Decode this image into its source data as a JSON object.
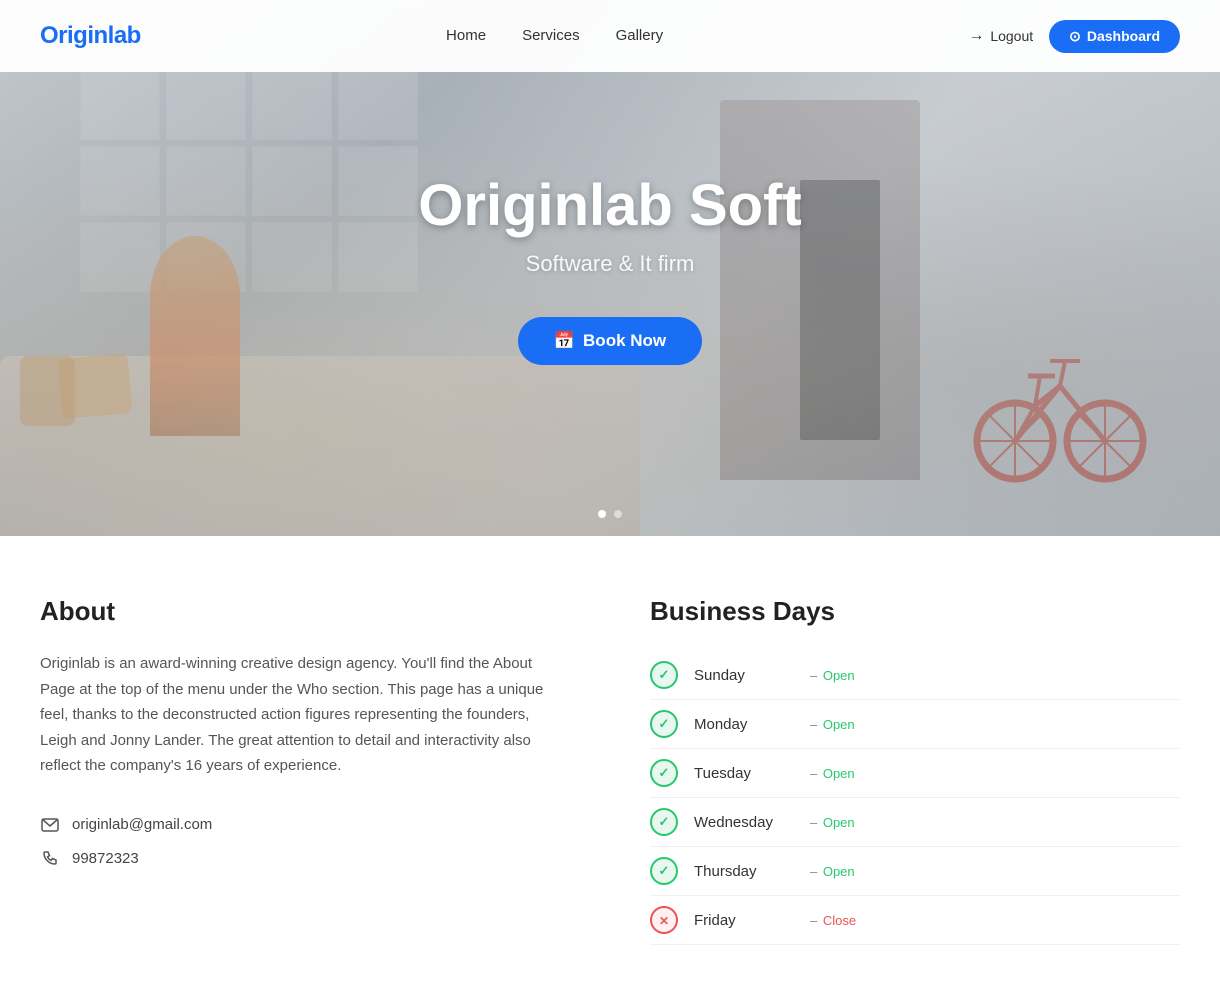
{
  "navbar": {
    "logo": "Originlab",
    "nav_items": [
      {
        "label": "Home",
        "href": "#"
      },
      {
        "label": "Services",
        "href": "#"
      },
      {
        "label": "Gallery",
        "href": "#"
      }
    ],
    "logout_label": "Logout",
    "dashboard_label": "Dashboard"
  },
  "hero": {
    "title": "Originlab Soft",
    "subtitle": "Software & It firm",
    "book_now_label": "Book Now",
    "dots": [
      {
        "active": true
      },
      {
        "active": false
      }
    ]
  },
  "about": {
    "title": "About",
    "body": "Originlab is an award-winning creative design agency. You'll find the About Page at the top of the menu under the Who section. This page has a unique feel, thanks to the deconstructed action figures representing the founders, Leigh and Jonny Lander. The great attention to detail and interactivity also reflect the company's 16 years of experience.",
    "email": "originlab@gmail.com",
    "phone": "99872323"
  },
  "business_days": {
    "title": "Business Days",
    "days": [
      {
        "name": "Sunday",
        "status": "open",
        "status_label": "Open"
      },
      {
        "name": "Monday",
        "status": "open",
        "status_label": "Open"
      },
      {
        "name": "Tuesday",
        "status": "open",
        "status_label": "Open"
      },
      {
        "name": "Wednesday",
        "status": "open",
        "status_label": "Open"
      },
      {
        "name": "Thursday",
        "status": "open",
        "status_label": "Open"
      },
      {
        "name": "Friday",
        "status": "close",
        "status_label": "Close"
      }
    ]
  }
}
